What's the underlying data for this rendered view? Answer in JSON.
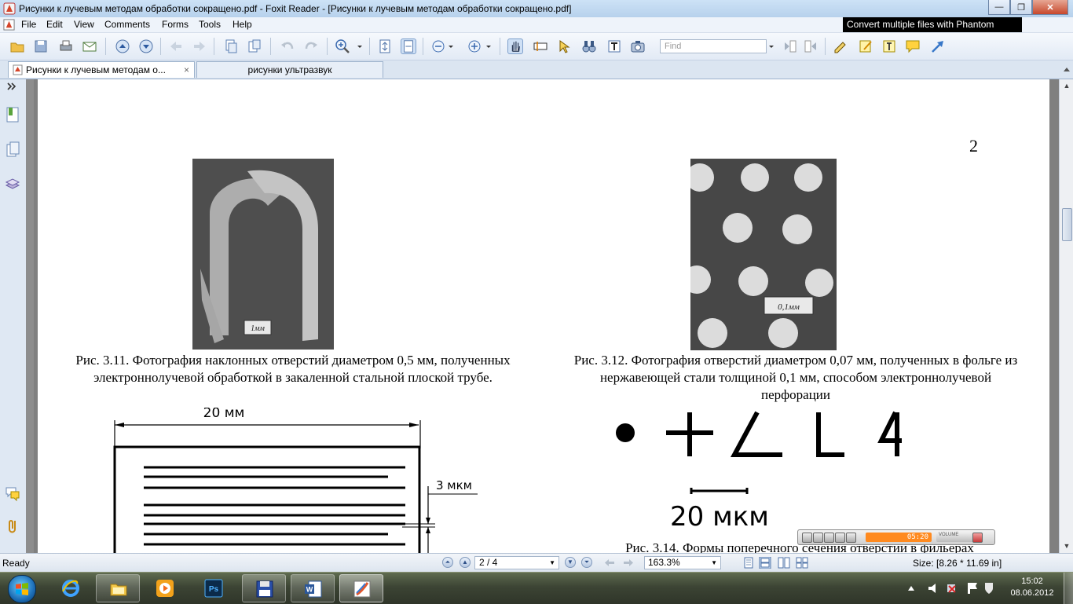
{
  "window": {
    "title": "Рисунки к лучевым методам обработки сокращено.pdf - Foxit Reader - [Рисунки к лучевым методам обработки сокращено.pdf]",
    "minimize": "—",
    "maximize": "❐",
    "close": "✕"
  },
  "menu": {
    "items": [
      "File",
      "Edit",
      "View",
      "Comments",
      "Forms",
      "Tools",
      "Help"
    ],
    "promo": "Convert multiple files with Phantom"
  },
  "toolbar": {
    "find_placeholder": "Find"
  },
  "tabs": [
    {
      "label": "Рисунки к лучевым методам о...",
      "close": "×"
    },
    {
      "label": "рисунки ультразвук"
    }
  ],
  "document": {
    "page_number": "2",
    "fig311_scale_label": "1мм",
    "fig312_scale_label": "0,1мм",
    "caption_311": "Рис. 3.11. Фотография наклонных отверстий диаметром 0,5 мм, полученных электроннолучевой обработкой в закаленной стальной плоской трубе.",
    "caption_312": "Рис. 3.12. Фотография отверстий диаметром 0,07 мм, полученных в фольге из нержавеющей стали толщиной 0,1 мм, способом электроннолучевой перфорации",
    "fig313_width_label": "20 мм",
    "fig313_gap_label": "3 мкм",
    "fig314_scale_label": "20 мкм",
    "caption_314_partial": "Рис. 3.14. Формы поперечного сечения отверстий в фильерах"
  },
  "media_player": {
    "time": "05:20",
    "volume_label": "VOLUME"
  },
  "status": {
    "ready": "Ready",
    "page": "2 / 4",
    "zoom": "163.3%",
    "size": "Size: [8.26 * 11.69 in]"
  },
  "clock": {
    "time": "15:02",
    "date": "08.06.2012"
  },
  "colors": {
    "accent": "#3b6fb6",
    "promo_bg": "#000000",
    "media_time": "#ff8a1f"
  }
}
